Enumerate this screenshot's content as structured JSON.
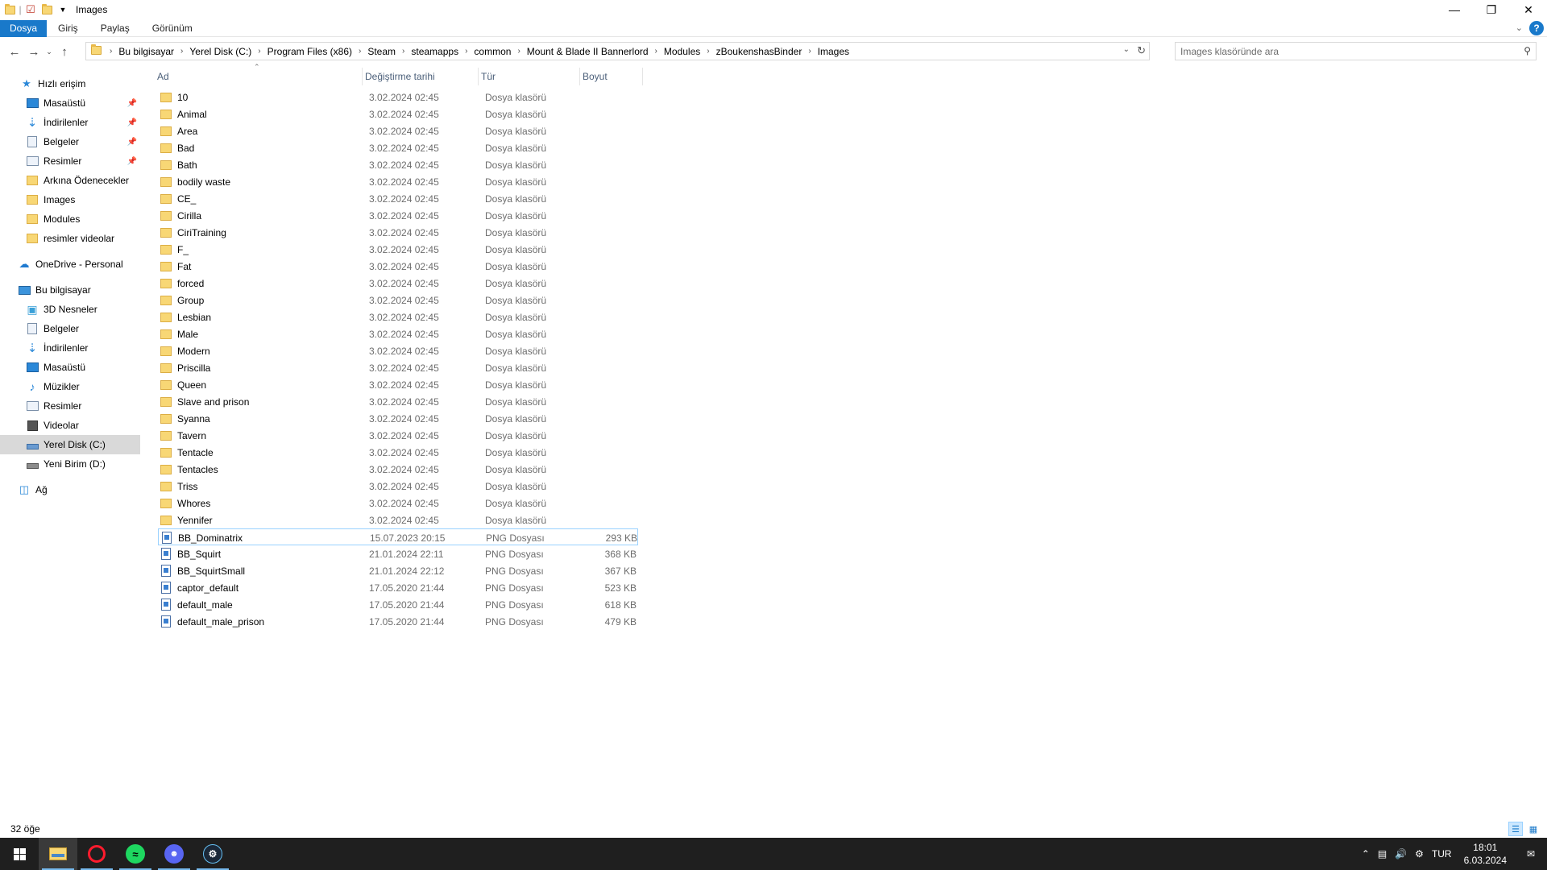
{
  "window": {
    "title": "Images"
  },
  "ribbon": {
    "tabs": [
      "Dosya",
      "Giriş",
      "Paylaş",
      "Görünüm"
    ]
  },
  "address": {
    "crumbs": [
      "Bu bilgisayar",
      "Yerel Disk (C:)",
      "Program Files (x86)",
      "Steam",
      "steamapps",
      "common",
      "Mount & Blade II Bannerlord",
      "Modules",
      "zBoukenshasBinder",
      "Images"
    ]
  },
  "search": {
    "placeholder": "Images klasöründe ara"
  },
  "nav": {
    "quick_access": "Hızlı erişim",
    "quick_items": [
      "Masaüstü",
      "İndirilenler",
      "Belgeler",
      "Resimler",
      "Arkına Ödenecekler",
      "Images",
      "Modules",
      "resimler videolar"
    ],
    "onedrive": "OneDrive - Personal",
    "this_pc": "Bu bilgisayar",
    "pc_items": [
      "3D Nesneler",
      "Belgeler",
      "İndirilenler",
      "Masaüstü",
      "Müzikler",
      "Resimler",
      "Videolar",
      "Yerel Disk (C:)",
      "Yeni Birim (D:)"
    ],
    "network": "Ağ"
  },
  "columns": {
    "name": "Ad",
    "date": "Değiştirme tarihi",
    "type": "Tür",
    "size": "Boyut"
  },
  "files": [
    {
      "name": "10",
      "date": "3.02.2024 02:45",
      "type": "Dosya klasörü",
      "size": "",
      "kind": "folder"
    },
    {
      "name": "Animal",
      "date": "3.02.2024 02:45",
      "type": "Dosya klasörü",
      "size": "",
      "kind": "folder"
    },
    {
      "name": "Area",
      "date": "3.02.2024 02:45",
      "type": "Dosya klasörü",
      "size": "",
      "kind": "folder"
    },
    {
      "name": "Bad",
      "date": "3.02.2024 02:45",
      "type": "Dosya klasörü",
      "size": "",
      "kind": "folder"
    },
    {
      "name": "Bath",
      "date": "3.02.2024 02:45",
      "type": "Dosya klasörü",
      "size": "",
      "kind": "folder"
    },
    {
      "name": "bodily waste",
      "date": "3.02.2024 02:45",
      "type": "Dosya klasörü",
      "size": "",
      "kind": "folder"
    },
    {
      "name": "CE_",
      "date": "3.02.2024 02:45",
      "type": "Dosya klasörü",
      "size": "",
      "kind": "folder"
    },
    {
      "name": "Cirilla",
      "date": "3.02.2024 02:45",
      "type": "Dosya klasörü",
      "size": "",
      "kind": "folder"
    },
    {
      "name": "CiriTraining",
      "date": "3.02.2024 02:45",
      "type": "Dosya klasörü",
      "size": "",
      "kind": "folder"
    },
    {
      "name": "F_",
      "date": "3.02.2024 02:45",
      "type": "Dosya klasörü",
      "size": "",
      "kind": "folder"
    },
    {
      "name": "Fat",
      "date": "3.02.2024 02:45",
      "type": "Dosya klasörü",
      "size": "",
      "kind": "folder"
    },
    {
      "name": "forced",
      "date": "3.02.2024 02:45",
      "type": "Dosya klasörü",
      "size": "",
      "kind": "folder"
    },
    {
      "name": "Group",
      "date": "3.02.2024 02:45",
      "type": "Dosya klasörü",
      "size": "",
      "kind": "folder"
    },
    {
      "name": "Lesbian",
      "date": "3.02.2024 02:45",
      "type": "Dosya klasörü",
      "size": "",
      "kind": "folder"
    },
    {
      "name": "Male",
      "date": "3.02.2024 02:45",
      "type": "Dosya klasörü",
      "size": "",
      "kind": "folder"
    },
    {
      "name": "Modern",
      "date": "3.02.2024 02:45",
      "type": "Dosya klasörü",
      "size": "",
      "kind": "folder"
    },
    {
      "name": "Priscilla",
      "date": "3.02.2024 02:45",
      "type": "Dosya klasörü",
      "size": "",
      "kind": "folder"
    },
    {
      "name": "Queen",
      "date": "3.02.2024 02:45",
      "type": "Dosya klasörü",
      "size": "",
      "kind": "folder"
    },
    {
      "name": "Slave and prison",
      "date": "3.02.2024 02:45",
      "type": "Dosya klasörü",
      "size": "",
      "kind": "folder"
    },
    {
      "name": "Syanna",
      "date": "3.02.2024 02:45",
      "type": "Dosya klasörü",
      "size": "",
      "kind": "folder"
    },
    {
      "name": "Tavern",
      "date": "3.02.2024 02:45",
      "type": "Dosya klasörü",
      "size": "",
      "kind": "folder"
    },
    {
      "name": "Tentacle",
      "date": "3.02.2024 02:45",
      "type": "Dosya klasörü",
      "size": "",
      "kind": "folder"
    },
    {
      "name": "Tentacles",
      "date": "3.02.2024 02:45",
      "type": "Dosya klasörü",
      "size": "",
      "kind": "folder"
    },
    {
      "name": "Triss",
      "date": "3.02.2024 02:45",
      "type": "Dosya klasörü",
      "size": "",
      "kind": "folder"
    },
    {
      "name": "Whores",
      "date": "3.02.2024 02:45",
      "type": "Dosya klasörü",
      "size": "",
      "kind": "folder"
    },
    {
      "name": "Yennifer",
      "date": "3.02.2024 02:45",
      "type": "Dosya klasörü",
      "size": "",
      "kind": "folder"
    },
    {
      "name": "BB_Dominatrix",
      "date": "15.07.2023 20:15",
      "type": "PNG Dosyası",
      "size": "293 KB",
      "kind": "png"
    },
    {
      "name": "BB_Squirt",
      "date": "21.01.2024 22:11",
      "type": "PNG Dosyası",
      "size": "368 KB",
      "kind": "png"
    },
    {
      "name": "BB_SquirtSmall",
      "date": "21.01.2024 22:12",
      "type": "PNG Dosyası",
      "size": "367 KB",
      "kind": "png"
    },
    {
      "name": "captor_default",
      "date": "17.05.2020 21:44",
      "type": "PNG Dosyası",
      "size": "523 KB",
      "kind": "png"
    },
    {
      "name": "default_male",
      "date": "17.05.2020 21:44",
      "type": "PNG Dosyası",
      "size": "618 KB",
      "kind": "png"
    },
    {
      "name": "default_male_prison",
      "date": "17.05.2020 21:44",
      "type": "PNG Dosyası",
      "size": "479 KB",
      "kind": "png"
    }
  ],
  "status": {
    "count": "32 öğe"
  },
  "taskbar": {
    "language": "TUR",
    "time": "18:01",
    "date": "6.03.2024"
  },
  "colors": {
    "accent": "#1979ca",
    "taskbar": "#1f1f1f",
    "folder": "#f8d775"
  }
}
